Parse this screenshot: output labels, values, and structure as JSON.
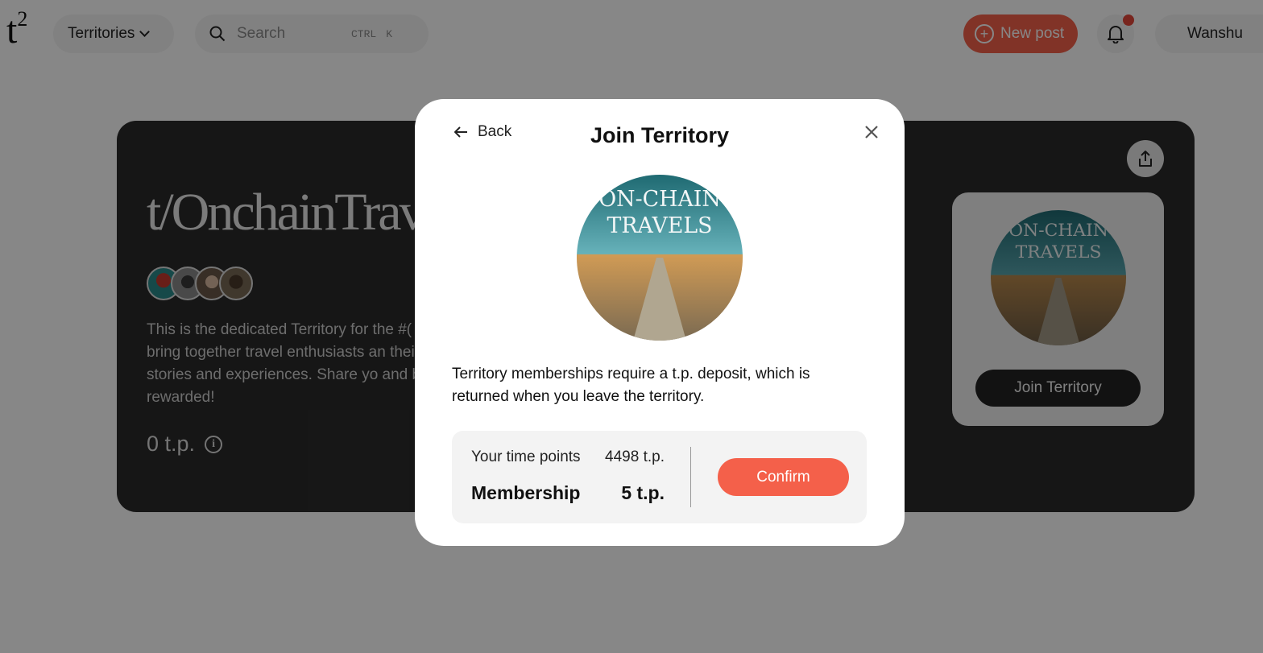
{
  "header": {
    "logo_text": "t",
    "logo_sup": "2",
    "territories_label": "Territories",
    "search_placeholder": "Search",
    "search_shortcut_1": "CTRL",
    "search_shortcut_2": "K",
    "new_post_label": "New post",
    "user_name": "Wanshu",
    "notification_dot_color": "#e2463a"
  },
  "territory": {
    "title": "t/OnchainTrav",
    "description": "This is the dedicated Territory for the #( we bring together travel enthusiasts an their stories and experiences. Share yo and be rewarded!",
    "points": "0 t.p.",
    "join_button_label": "Join Territory",
    "logo_line_1": "ON-CHAIN",
    "logo_line_2": "TRAVELS"
  },
  "modal": {
    "back_label": "Back",
    "title": "Join Territory",
    "logo_line_1": "ON-CHAIN",
    "logo_line_2": "TRAVELS",
    "info_text": "Territory memberships require a t.p. deposit, which is returned when you leave the territory.",
    "time_points_label": "Your time points",
    "time_points_value": "4498 t.p.",
    "membership_label": "Membership",
    "membership_value": "5 t.p.",
    "confirm_label": "Confirm"
  },
  "colors": {
    "accent": "#f4604a",
    "hero_bg": "#2b2b2b",
    "overlay": "rgba(0,0,0,0.47)"
  },
  "icons": [
    "search-icon",
    "chevron-down-icon",
    "plus-circle-icon",
    "bell-icon",
    "share-icon",
    "info-icon",
    "arrow-left-icon",
    "close-icon"
  ]
}
